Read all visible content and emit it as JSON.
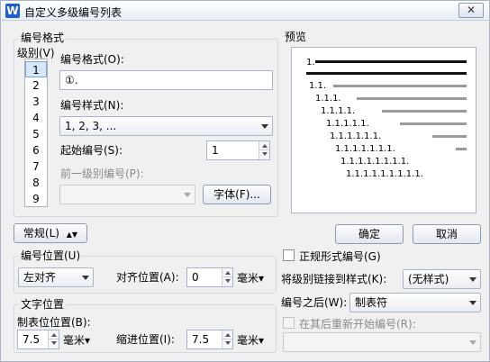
{
  "window": {
    "title": "自定义多级编号列表",
    "close_label": "✕",
    "app_icon": "W"
  },
  "format_group": {
    "header": "编号格式",
    "level_label": "级别(V)",
    "levels": [
      "1",
      "2",
      "3",
      "4",
      "5",
      "6",
      "7",
      "8",
      "9"
    ],
    "selected_level": "1",
    "number_format_label": "编号格式(O):",
    "number_format_value": "①.",
    "number_style_label": "编号样式(N):",
    "number_style_value": "1, 2, 3, ...",
    "start_at_label": "起始编号(S):",
    "start_at_value": "1",
    "prev_level_label": "前一级别编号(P):",
    "prev_level_value": "",
    "font_button": "字体(F)..."
  },
  "preview": {
    "header": "预览",
    "items": [
      "1.",
      "1.1.",
      "1.1.1.",
      "1.1.1.1.",
      "1.1.1.1.1.",
      "1.1.1.1.1.1.",
      "1.1.1.1.1.1.1.",
      "1.1.1.1.1.1.1.1.",
      "1.1.1.1.1.1.1.1.1."
    ]
  },
  "buttons": {
    "general": "常规(L)",
    "ok": "确定",
    "cancel": "取消"
  },
  "position_group": {
    "header": "编号位置(U)",
    "align_value": "左对齐",
    "align_at_label": "对齐位置(A):",
    "align_at_value": "0",
    "unit": "毫米▾"
  },
  "text_position_group": {
    "header": "文字位置",
    "tab_stop_label": "制表位位置(B):",
    "tab_stop_value": "7.5",
    "indent_label": "缩进位置(I):",
    "indent_value": "7.5",
    "unit": "毫米▾"
  },
  "right_options": {
    "legal_style_label": "正规形式编号(G)",
    "link_style_label": "将级别链接到样式(K):",
    "link_style_value": "(无样式)",
    "follow_with_label": "编号之后(W):",
    "follow_with_value": "制表符",
    "restart_label": "在其后重新开始编号(R):",
    "restart_value": ""
  }
}
